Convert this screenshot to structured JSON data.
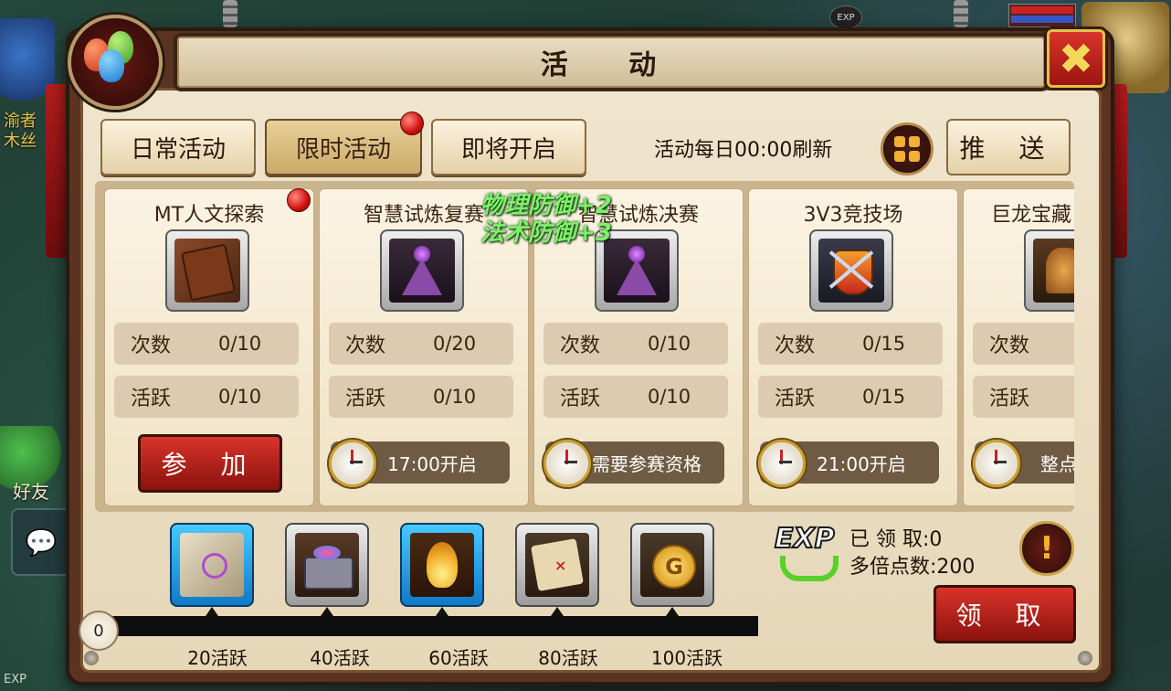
{
  "window": {
    "title": "活 动"
  },
  "background": {
    "left_name": "渝者\n木丝",
    "friend_label": "好友",
    "exp_bottom": "EXP",
    "exp_top": "EXP"
  },
  "tabs": [
    {
      "label": "日常活动",
      "active": false,
      "has_dot": false
    },
    {
      "label": "限时活动",
      "active": true,
      "has_dot": true
    },
    {
      "label": "即将开启",
      "active": false,
      "has_dot": false
    }
  ],
  "refresh_text": "活动每日00:00刷新",
  "push_label": "推 送",
  "stat_labels": {
    "count": "次数",
    "active": "活跃"
  },
  "cards": [
    {
      "title": "MT人文探索",
      "icon": "book-icon",
      "count": "0/10",
      "active": "0/10",
      "action": "button",
      "action_label": "参 加",
      "has_dot": true
    },
    {
      "title": "智慧试炼复赛",
      "icon": "wisdom-trial-icon",
      "count": "0/20",
      "active": "0/10",
      "action": "time",
      "action_label": "17:00开启",
      "has_dot": false
    },
    {
      "title": "智慧试炼决赛",
      "icon": "wisdom-trial-icon",
      "count": "0/10",
      "active": "0/10",
      "action": "time",
      "action_label": "需要参赛资格",
      "has_dot": false
    },
    {
      "title": "3V3竞技场",
      "icon": "arena-shield-icon",
      "count": "0/15",
      "active": "0/15",
      "action": "time",
      "action_label": "21:00开启",
      "has_dot": false
    },
    {
      "title": "巨龙宝藏",
      "icon": "dragon-statue-icon",
      "count": "",
      "active": "",
      "action": "time",
      "action_label": "整点",
      "has_dot": false
    }
  ],
  "floating_buffs": [
    "物理防御+2",
    "法术防御+3"
  ],
  "rewards": [
    {
      "icon": "rune-stone-icon",
      "glow": true,
      "label": "20活跃"
    },
    {
      "icon": "treasure-chest-icon",
      "glow": false,
      "label": "40活跃"
    },
    {
      "icon": "golden-flame-icon",
      "glow": true,
      "label": "60活跃"
    },
    {
      "icon": "treasure-map-icon",
      "glow": false,
      "label": "80活跃"
    },
    {
      "icon": "gold-coin-icon",
      "glow": false,
      "label": "100活跃"
    }
  ],
  "progress": {
    "current_label": "0",
    "value": 0,
    "max": 100
  },
  "exp_info": {
    "badge": "EXP",
    "claimed": "已 领 取:0",
    "multiplier": "多倍点数:200"
  },
  "claim_label": "领 取",
  "colors": {
    "accent_red": "#c8261c",
    "gold": "#f2b12e",
    "parchment": "#efe4cd",
    "buff_green": "#7ff06a"
  }
}
